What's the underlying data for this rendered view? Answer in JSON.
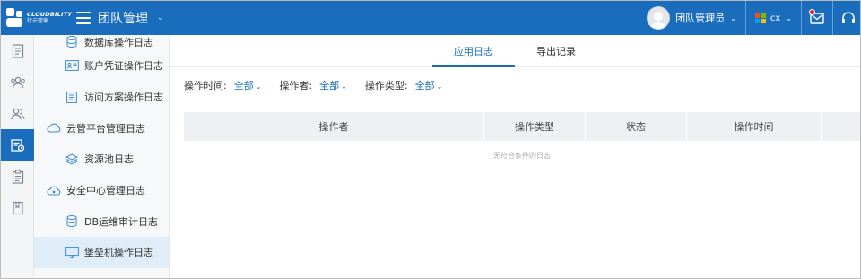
{
  "brand": {
    "name_en": "CLOUDBILITY",
    "name_cn": "行云管家",
    "accent": "#1a6dbd"
  },
  "header": {
    "team_title": "团队管理",
    "user_name": "团队管理员",
    "org_label": "cx",
    "icons": [
      "menu-icon",
      "chevron-down-icon",
      "avatar",
      "windows-icon",
      "mail-icon",
      "headset-icon"
    ]
  },
  "rail": {
    "items": [
      {
        "icon": "document-icon",
        "active": false
      },
      {
        "icon": "group-icon",
        "active": false
      },
      {
        "icon": "users-icon",
        "active": false
      },
      {
        "icon": "log-audit-icon",
        "active": true
      },
      {
        "icon": "clipboard-icon",
        "active": false
      },
      {
        "icon": "book-icon",
        "active": false
      }
    ]
  },
  "submenu": {
    "items": [
      {
        "label": "数据库操作日志",
        "icon": "database-icon",
        "level": 2
      },
      {
        "label": "账户凭证操作日志",
        "icon": "id-card-icon",
        "level": 2
      },
      {
        "label": "访问方案操作日志",
        "icon": "clipboard-list-icon",
        "level": 2
      },
      {
        "label": "云管平台管理日志",
        "icon": "cloud-icon",
        "level": 1
      },
      {
        "label": "资源池日志",
        "icon": "layers-icon",
        "level": 2
      },
      {
        "label": "安全中心管理日志",
        "icon": "eye-cloud-icon",
        "level": 1
      },
      {
        "label": "DB运维审计日志",
        "icon": "database-icon",
        "level": 2
      },
      {
        "label": "堡垒机操作日志",
        "icon": "monitor-icon",
        "level": 2,
        "active": true
      }
    ]
  },
  "main": {
    "tabs": [
      {
        "label": "应用日志",
        "active": true
      },
      {
        "label": "导出记录",
        "active": false
      }
    ],
    "filters": [
      {
        "label": "操作时间:",
        "value": "全部"
      },
      {
        "label": "操作者:",
        "value": "全部"
      },
      {
        "label": "操作类型:",
        "value": "全部"
      }
    ],
    "table": {
      "columns": [
        "操作者",
        "操作类型",
        "状态",
        "操作时间",
        ""
      ],
      "empty_text": "无符合条件的日志"
    }
  }
}
